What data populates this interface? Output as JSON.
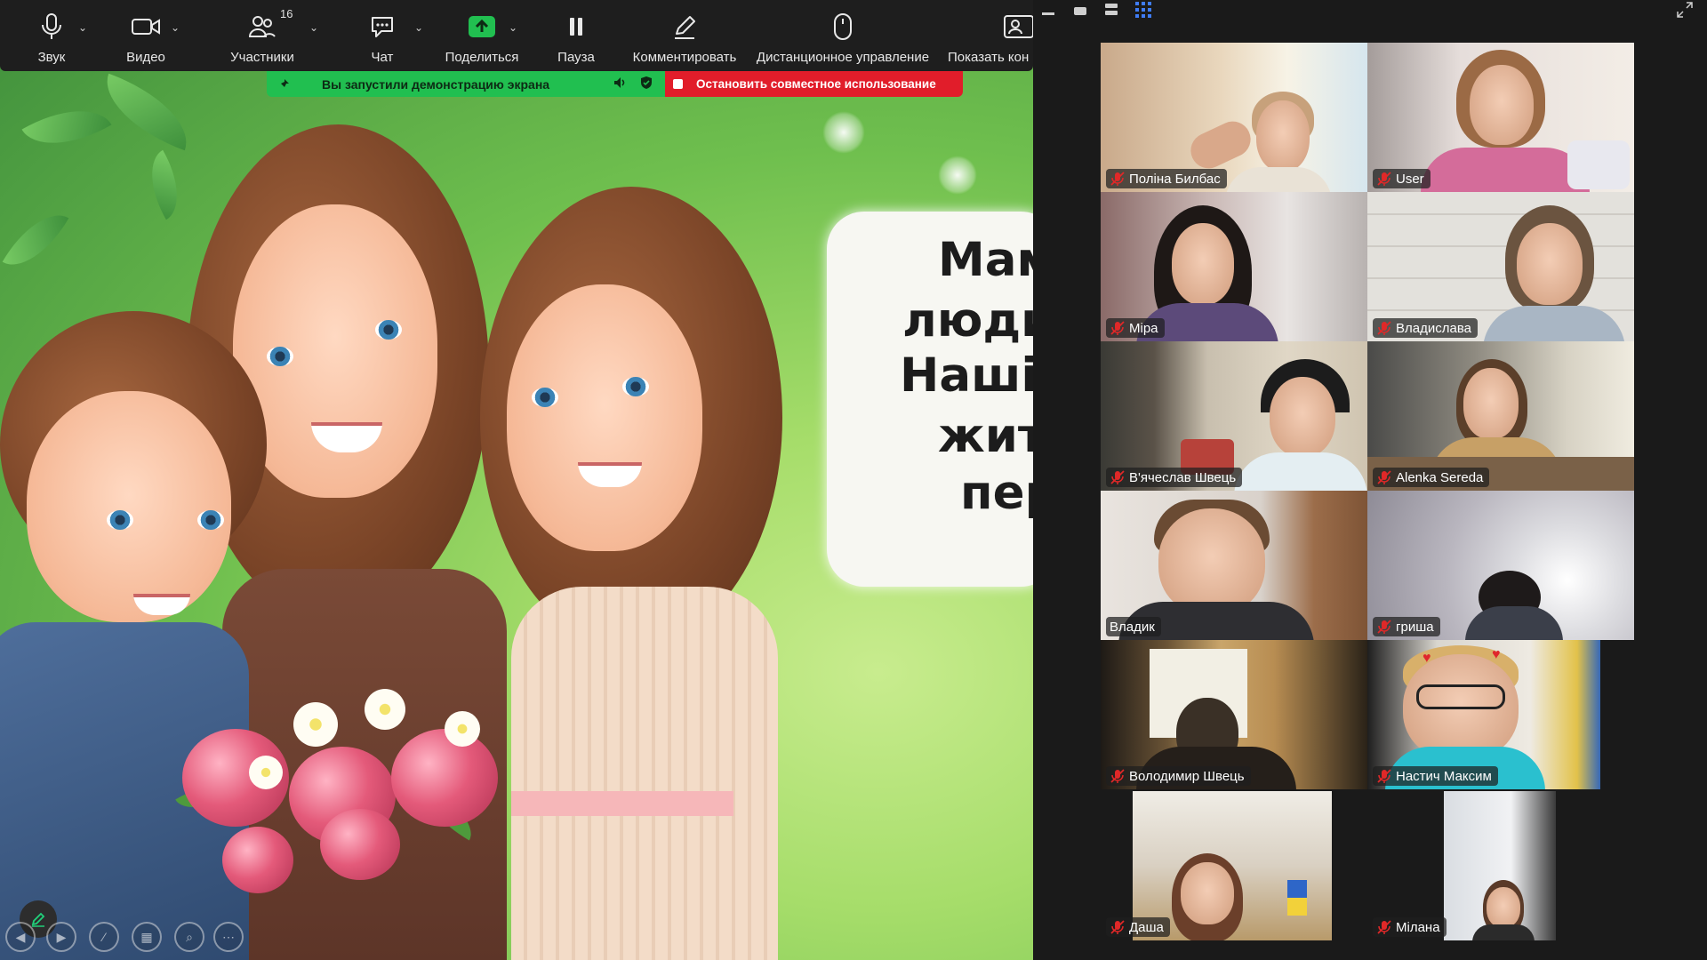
{
  "toolbar": {
    "items": [
      {
        "label": "Звук",
        "icon": "microphone-icon"
      },
      {
        "label": "Видео",
        "icon": "video-camera-icon"
      },
      {
        "label": "Участники",
        "icon": "participants-icon",
        "count": "16"
      },
      {
        "label": "Чат",
        "icon": "chat-icon"
      },
      {
        "label": "Поделиться",
        "icon": "share-screen-icon"
      },
      {
        "label": "Пауза",
        "icon": "pause-icon"
      },
      {
        "label": "Комментировать",
        "icon": "annotate-pen-icon"
      },
      {
        "label": "Дистанционное управление",
        "icon": "mouse-icon"
      },
      {
        "label": "Показать кон",
        "icon": "show-contacts-icon"
      }
    ]
  },
  "share_banner": {
    "status": "Вы запустили демонстрацию экрана",
    "stop_label": "Остановить совместное использование",
    "status_color": "#21bf50",
    "stop_color": "#e11d2a"
  },
  "slide": {
    "lines": [
      "Мам",
      "люди",
      "Наші",
      "житт",
      "пер"
    ]
  },
  "gallery": {
    "participants": [
      {
        "name": "Поліна Билбас",
        "muted": true
      },
      {
        "name": "User",
        "muted": true
      },
      {
        "name": "Міра",
        "muted": true
      },
      {
        "name": "Владислава",
        "muted": true
      },
      {
        "name": "В'ячеслав Швець",
        "muted": true
      },
      {
        "name": "Alenka Sereda",
        "muted": true
      },
      {
        "name": "Владик",
        "muted": false
      },
      {
        "name": "гриша",
        "muted": true
      },
      {
        "name": "Володимир Швець",
        "muted": true
      },
      {
        "name": "Настич Максим",
        "muted": true
      },
      {
        "name": "Даша",
        "muted": true
      },
      {
        "name": "Мілана",
        "muted": true
      }
    ]
  }
}
